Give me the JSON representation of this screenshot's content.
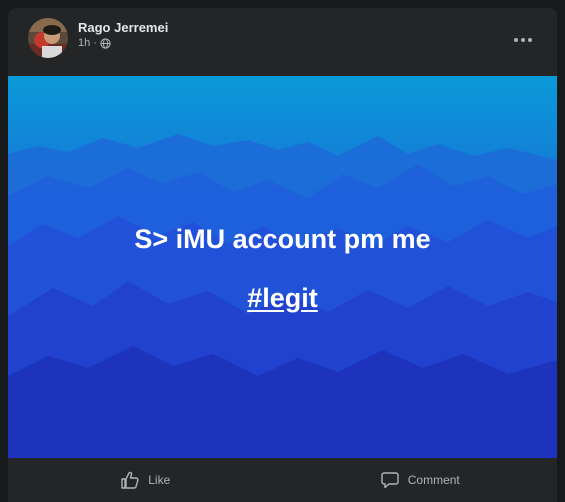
{
  "post": {
    "author": "Rago Jerremei",
    "time": "1h",
    "separator": "·",
    "audience_icon": "globe-icon",
    "more_icon": "more-options-icon",
    "banner": {
      "line1": "S> iMU account pm me",
      "line2": "#legit",
      "bg_colors": [
        "#0a9ad8",
        "#1f5fdc",
        "#1c2fb8"
      ]
    },
    "actions": {
      "like": {
        "label": "Like",
        "icon": "thumbs-up-icon"
      },
      "comment": {
        "label": "Comment",
        "icon": "comment-icon"
      }
    }
  }
}
